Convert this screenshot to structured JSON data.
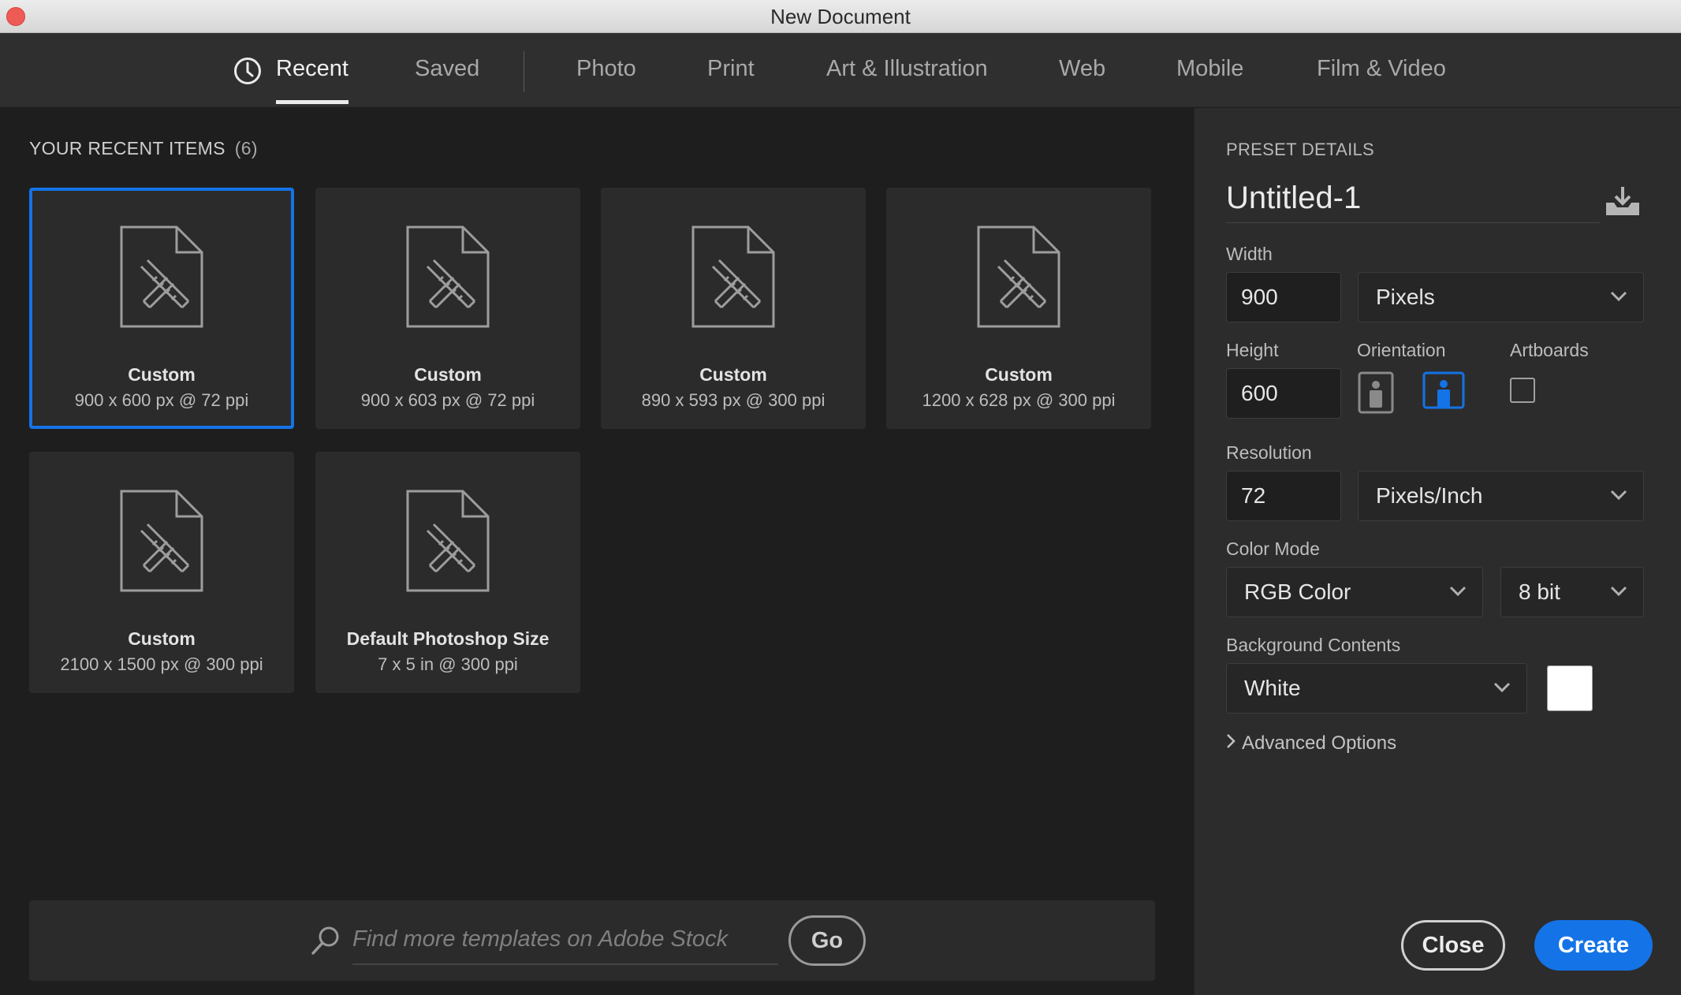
{
  "window": {
    "title": "New Document"
  },
  "tabs": [
    {
      "label": "Recent",
      "active": true
    },
    {
      "label": "Saved"
    },
    {
      "label": "Photo"
    },
    {
      "label": "Print"
    },
    {
      "label": "Art & Illustration"
    },
    {
      "label": "Web"
    },
    {
      "label": "Mobile"
    },
    {
      "label": "Film & Video"
    }
  ],
  "recent": {
    "heading": "YOUR RECENT ITEMS",
    "count": "(6)",
    "items": [
      {
        "title": "Custom",
        "subtitle": "900 x 600 px @ 72 ppi",
        "selected": true
      },
      {
        "title": "Custom",
        "subtitle": "900 x 603 px @ 72 ppi"
      },
      {
        "title": "Custom",
        "subtitle": "890 x 593 px @ 300 ppi"
      },
      {
        "title": "Custom",
        "subtitle": "1200 x 628 px @ 300 ppi"
      },
      {
        "title": "Custom",
        "subtitle": "2100 x 1500 px @ 300 ppi"
      },
      {
        "title": "Default Photoshop Size",
        "subtitle": "7 x 5 in @ 300 ppi"
      }
    ]
  },
  "stock": {
    "placeholder": "Find more templates on Adobe Stock",
    "go_label": "Go"
  },
  "preset": {
    "heading": "PRESET DETAILS",
    "name": "Untitled-1",
    "width_label": "Width",
    "width_value": "900",
    "width_unit": "Pixels",
    "height_label": "Height",
    "height_value": "600",
    "orientation_label": "Orientation",
    "orientation_selected": "landscape",
    "artboards_label": "Artboards",
    "artboards_checked": false,
    "resolution_label": "Resolution",
    "resolution_value": "72",
    "resolution_unit": "Pixels/Inch",
    "color_mode_label": "Color Mode",
    "color_mode": "RGB Color",
    "bit_depth": "8 bit",
    "background_label": "Background Contents",
    "background": "White",
    "background_color": "#ffffff",
    "advanced_label": "Advanced Options"
  },
  "buttons": {
    "close": "Close",
    "create": "Create"
  },
  "colors": {
    "accent": "#1473e6",
    "close_dot": "#ee5b54"
  }
}
